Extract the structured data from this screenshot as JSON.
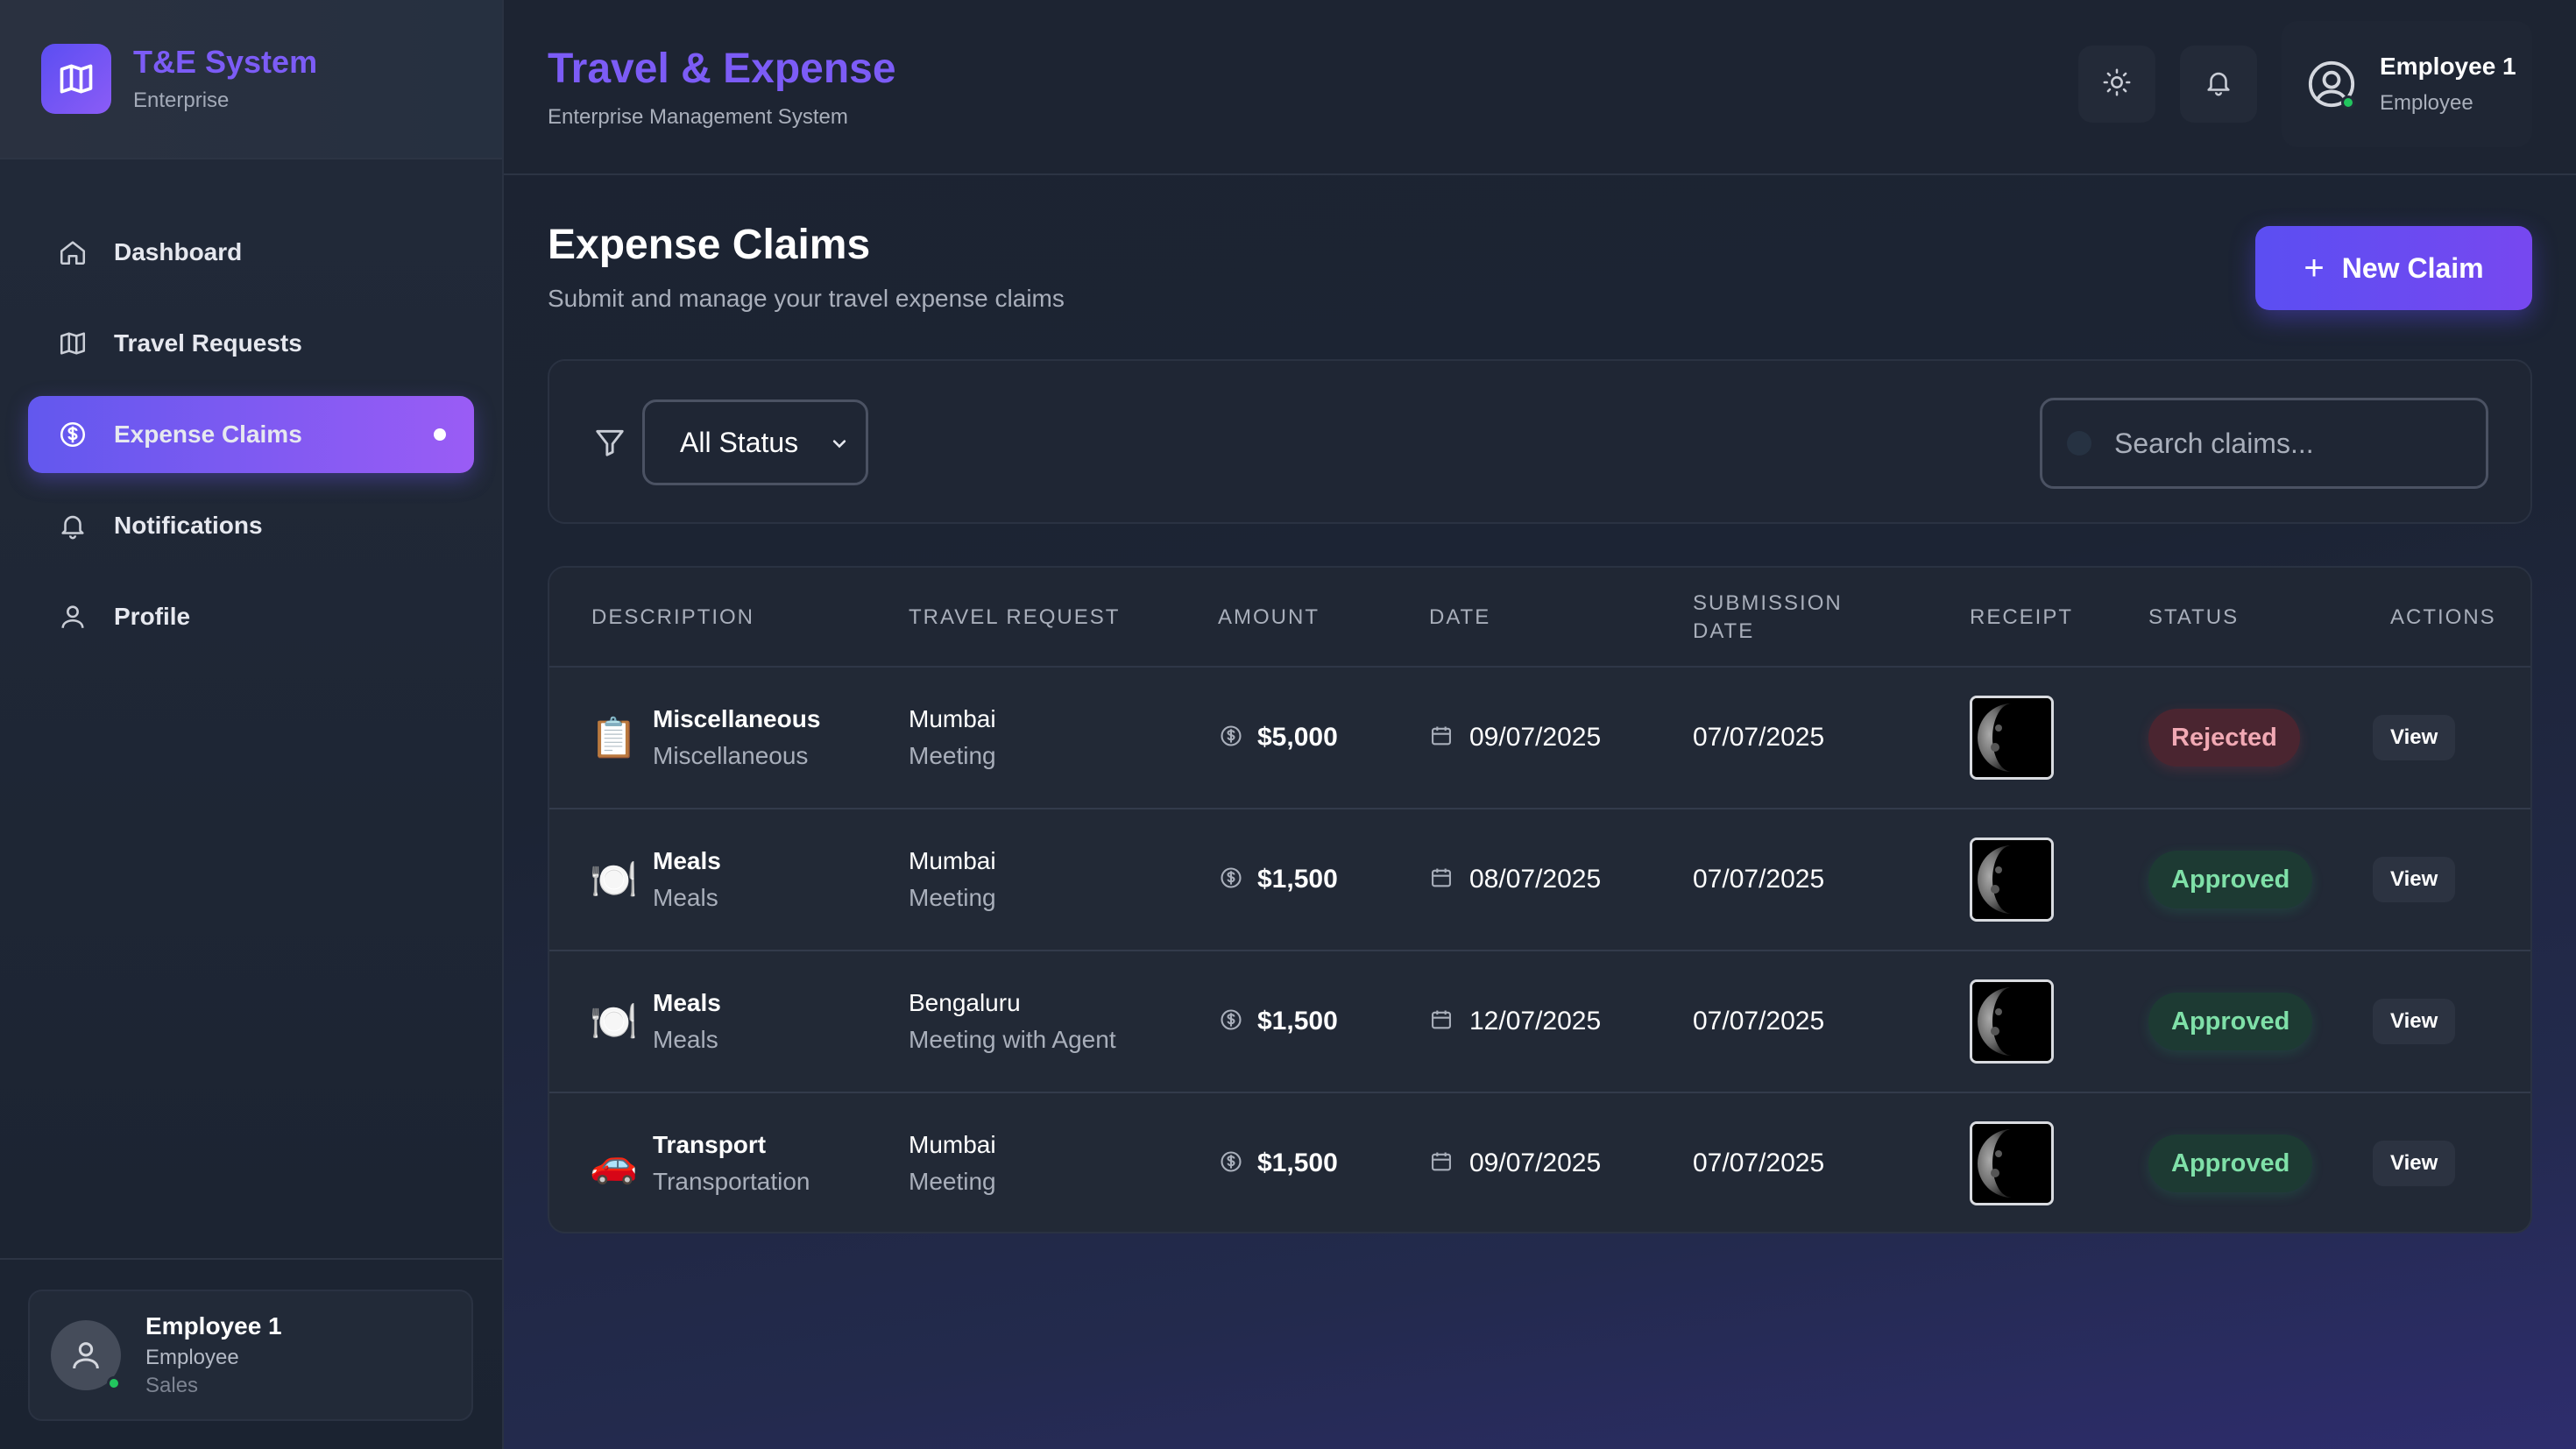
{
  "brand": {
    "title": "T&E System",
    "subtitle": "Enterprise"
  },
  "sidebar": {
    "items": [
      {
        "label": "Dashboard",
        "icon": "home-icon",
        "active": false
      },
      {
        "label": "Travel Requests",
        "icon": "map-icon",
        "active": false
      },
      {
        "label": "Expense Claims",
        "icon": "dollar-circle-icon",
        "active": true
      },
      {
        "label": "Notifications",
        "icon": "bell-icon",
        "active": false
      },
      {
        "label": "Profile",
        "icon": "user-icon",
        "active": false
      }
    ],
    "user": {
      "name": "Employee 1",
      "role": "Employee",
      "department": "Sales"
    }
  },
  "header": {
    "title": "Travel & Expense",
    "subtitle": "Enterprise Management System",
    "user": {
      "name": "Employee 1",
      "role": "Employee"
    }
  },
  "page": {
    "title": "Expense Claims",
    "subtitle": "Submit and manage your travel expense claims",
    "new_claim_label": "New Claim"
  },
  "filters": {
    "status_selected": "All Status",
    "search_placeholder": "Search claims..."
  },
  "table": {
    "columns": [
      "DESCRIPTION",
      "TRAVEL REQUEST",
      "AMOUNT",
      "DATE",
      "SUBMISSION DATE",
      "RECEIPT",
      "STATUS",
      "ACTIONS"
    ],
    "rows": [
      {
        "emoji": "📋",
        "title": "Miscellaneous",
        "category": "Miscellaneous",
        "city": "Mumbai",
        "purpose": "Meeting",
        "amount": "$5,000",
        "date": "09/07/2025",
        "submission_date": "07/07/2025",
        "status": "Rejected",
        "action": "View"
      },
      {
        "emoji": "🍽️",
        "title": "Meals",
        "category": "Meals",
        "city": "Mumbai",
        "purpose": "Meeting",
        "amount": "$1,500",
        "date": "08/07/2025",
        "submission_date": "07/07/2025",
        "status": "Approved",
        "action": "View"
      },
      {
        "emoji": "🍽️",
        "title": "Meals",
        "category": "Meals",
        "city": "Bengaluru",
        "purpose": "Meeting with Agent",
        "amount": "$1,500",
        "date": "12/07/2025",
        "submission_date": "07/07/2025",
        "status": "Approved",
        "action": "View"
      },
      {
        "emoji": "🚗",
        "title": "Transport",
        "category": "Transportation",
        "city": "Mumbai",
        "purpose": "Meeting",
        "amount": "$1,500",
        "date": "09/07/2025",
        "submission_date": "07/07/2025",
        "status": "Approved",
        "action": "View"
      }
    ]
  },
  "colors": {
    "accent": "#7c5cf6",
    "approved": "#7fe0a8",
    "rejected": "#f1a9b4",
    "online": "#22c55e"
  }
}
